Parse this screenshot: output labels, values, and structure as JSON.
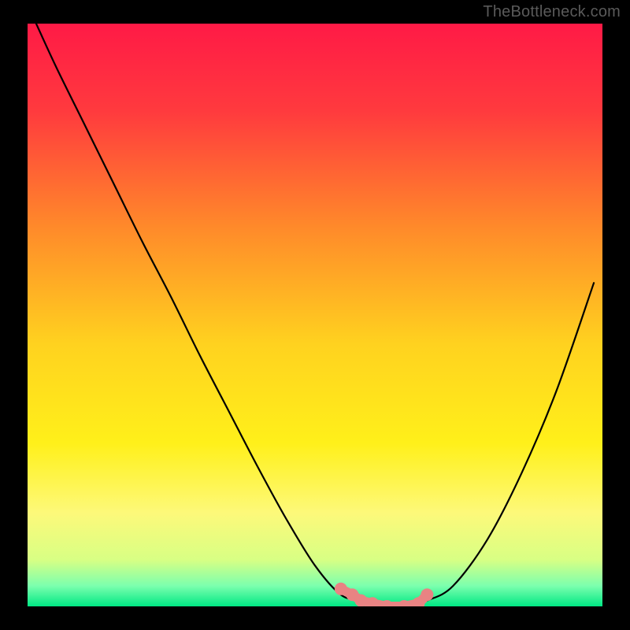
{
  "watermark": "TheBottleneck.com",
  "gradient": {
    "stops": [
      {
        "offset": 0.0,
        "color": "#ff1a46"
      },
      {
        "offset": 0.15,
        "color": "#ff3a3e"
      },
      {
        "offset": 0.35,
        "color": "#ff8a2a"
      },
      {
        "offset": 0.55,
        "color": "#ffd21f"
      },
      {
        "offset": 0.72,
        "color": "#fff01a"
      },
      {
        "offset": 0.84,
        "color": "#fdf97a"
      },
      {
        "offset": 0.92,
        "color": "#d8ff84"
      },
      {
        "offset": 0.965,
        "color": "#7bffae"
      },
      {
        "offset": 1.0,
        "color": "#00e884"
      }
    ]
  },
  "chart_data": {
    "type": "line",
    "title": "",
    "xlabel": "",
    "ylabel": "",
    "xlim": [
      0,
      1
    ],
    "ylim": [
      0,
      1
    ],
    "series": [
      {
        "name": "curve",
        "x": [
          0.015,
          0.05,
          0.1,
          0.15,
          0.2,
          0.25,
          0.3,
          0.35,
          0.4,
          0.45,
          0.5,
          0.545,
          0.58,
          0.615,
          0.66,
          0.695,
          0.74,
          0.8,
          0.86,
          0.92,
          0.985
        ],
        "y": [
          1.0,
          0.925,
          0.825,
          0.725,
          0.625,
          0.53,
          0.43,
          0.335,
          0.24,
          0.15,
          0.07,
          0.02,
          0.01,
          0.0,
          0.0,
          0.01,
          0.035,
          0.115,
          0.23,
          0.37,
          0.555
        ]
      }
    ],
    "markers": {
      "name": "worm-markers",
      "color": "#e98383",
      "x": [
        0.545,
        0.565,
        0.58,
        0.6,
        0.625,
        0.655,
        0.68,
        0.695
      ],
      "y": [
        0.03,
        0.02,
        0.01,
        0.005,
        0.0,
        0.0,
        0.005,
        0.02
      ]
    }
  }
}
